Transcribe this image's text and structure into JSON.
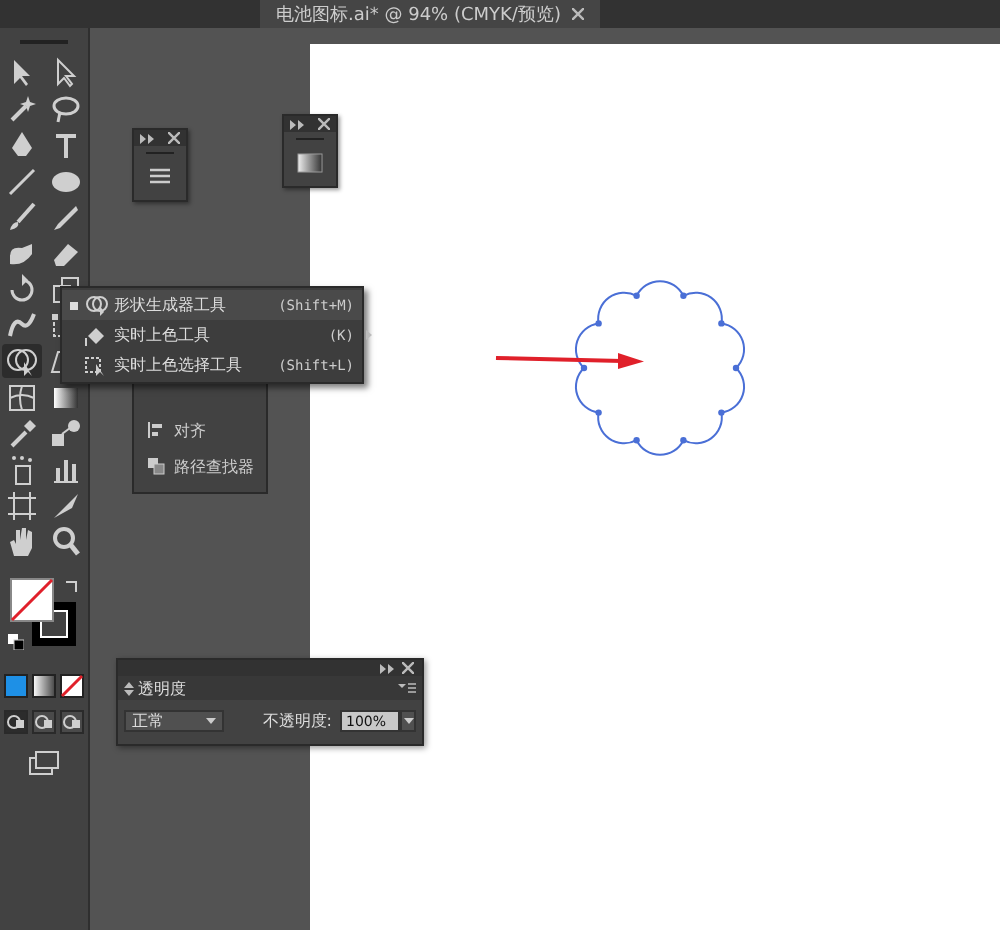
{
  "document_tab": {
    "title": "电池图标.ai* @ 94% (CMYK/预览)"
  },
  "flyout": {
    "items": [
      {
        "label": "形状生成器工具",
        "shortcut": "(Shift+M)",
        "selected": true
      },
      {
        "label": "实时上色工具",
        "shortcut": "(K)",
        "selected": false
      },
      {
        "label": "实时上色选择工具",
        "shortcut": "(Shift+L)",
        "selected": false
      }
    ]
  },
  "panel_list": {
    "items": [
      "对齐",
      "路径查找器"
    ]
  },
  "transparency_panel": {
    "title": "透明度",
    "blend_mode": "正常",
    "opacity_label": "不透明度:",
    "opacity": "100%"
  }
}
